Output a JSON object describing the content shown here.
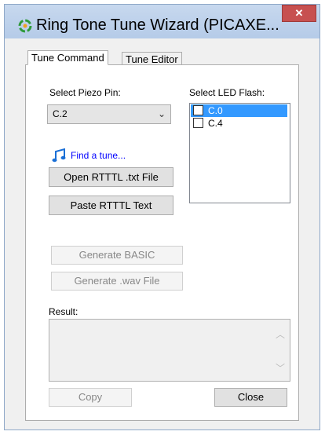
{
  "window": {
    "title": "Ring Tone Tune Wizard (PICAXE...",
    "close_glyph": "✕"
  },
  "tabs": [
    {
      "label": "Tune Command",
      "active": true
    },
    {
      "label": "Tune Editor",
      "active": false
    }
  ],
  "piezo": {
    "label": "Select Piezo Pin:",
    "selected": "C.2"
  },
  "led": {
    "label": "Select LED Flash:",
    "options": [
      {
        "label": "C.0",
        "checked": false,
        "selected": true
      },
      {
        "label": "C.4",
        "checked": false,
        "selected": false
      }
    ]
  },
  "find_tune": {
    "label": "Find a tune..."
  },
  "buttons": {
    "open_file": "Open RTTTL .txt File",
    "paste_text": "Paste RTTTL Text",
    "generate_basic": "Generate BASIC",
    "generate_wav": "Generate .wav File",
    "copy": "Copy",
    "close": "Close"
  },
  "result": {
    "label": "Result:",
    "value": ""
  },
  "colors": {
    "title_bar": "#c7d8ee",
    "close_button": "#c75050",
    "selection": "#3399ff",
    "link": "#0000ff"
  }
}
